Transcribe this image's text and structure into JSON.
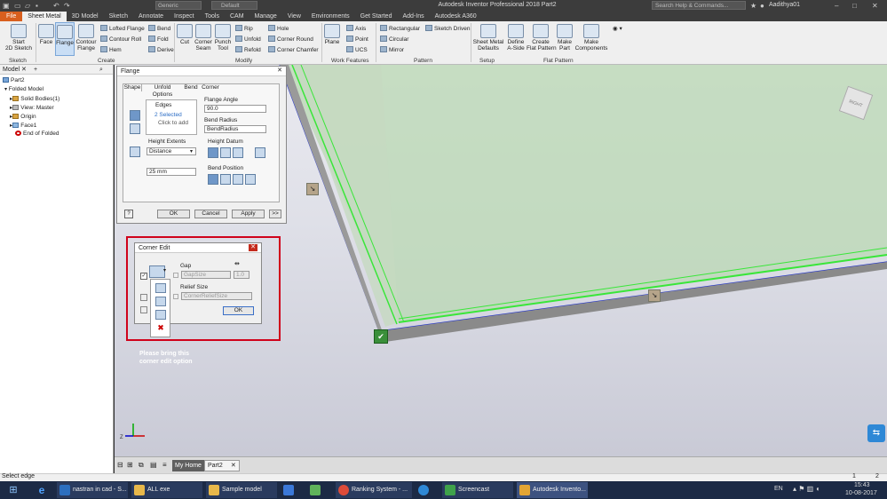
{
  "app": {
    "title": "Autodesk Inventor Professional 2018    Part2",
    "search_placeholder": "Search Help & Commands...",
    "user": "Aadithya01",
    "material": "Generic",
    "appearance": "Default"
  },
  "menu_tabs": [
    "File",
    "Sheet Metal",
    "3D Model",
    "Sketch",
    "Annotate",
    "Inspect",
    "Tools",
    "CAM",
    "Manage",
    "View",
    "Environments",
    "Get Started",
    "Add-Ins",
    "Autodesk A360"
  ],
  "ribbon": {
    "start_sketch": "Start\n2D Sketch",
    "face": "Face",
    "flange": "Flange",
    "contour_flange": "Contour\nFlange",
    "lofted_flange": "Lofted Flange",
    "contour_roll": "Contour Roll",
    "hem": "Hem",
    "bend": "Bend",
    "fold": "Fold",
    "derive": "Derive",
    "cut": "Cut",
    "corner_seam": "Corner\nSeam",
    "punch_tool": "Punch\nTool",
    "rip": "Rip",
    "unfold": "Unfold",
    "refold": "Refold",
    "hole": "Hole",
    "corner_round": "Corner Round",
    "corner_chamfer": "Corner Chamfer",
    "plane": "Plane",
    "axis": "Axis",
    "point": "Point",
    "ucs": "UCS",
    "rectangular": "Rectangular",
    "circular": "Circular",
    "mirror": "Mirror",
    "sketch_driven": "Sketch Driven",
    "sheet_metal_defaults": "Sheet Metal\nDefaults",
    "define_aside": "Define\nA-Side",
    "create_flat_pattern": "Create\nFlat Pattern",
    "make_part": "Make\nPart",
    "make_components": "Make\nComponents",
    "groups": {
      "sketch": "Sketch",
      "create": "Create",
      "modify": "Modify",
      "work_features": "Work Features",
      "pattern": "Pattern",
      "setup": "Setup",
      "flat_pattern": "Flat Pattern"
    }
  },
  "browser": {
    "header": "Model",
    "items": [
      "Part2",
      "Folded Model",
      "Solid Bodies(1)",
      "View: Master",
      "Origin",
      "Face1",
      "End of Folded"
    ]
  },
  "flange_dialog": {
    "title": "Flange",
    "tabs": [
      "Shape",
      "Unfold Options",
      "Bend",
      "Corner"
    ],
    "edges_label": "Edges",
    "edges_selected": "2 Selected",
    "edges_add": "Click to add",
    "flange_angle_label": "Flange Angle",
    "flange_angle": "90.0",
    "bend_radius_label": "Bend Radius",
    "bend_radius": "BendRadius",
    "height_extents_label": "Height Extents",
    "height_extents": "Distance",
    "height_value": "25 mm",
    "height_datum_label": "Height Datum",
    "bend_position_label": "Bend Position",
    "ok": "OK",
    "cancel": "Cancel",
    "apply": "Apply",
    "more": ">>"
  },
  "corner_edit": {
    "title": "Corner Edit",
    "gap_label": "Gap",
    "gap_value": "GapSize",
    "gap_num": "1.0",
    "relief_label": "Relief Size",
    "relief_value": "CornerReliefSize",
    "ok": "OK"
  },
  "annotation": "Please bring this\ncorner edit option",
  "doc_tabs": [
    "My Home",
    "Part2"
  ],
  "status": {
    "left": "Select edge",
    "n1": "1",
    "n2": "2"
  },
  "taskbar": {
    "items": [
      "nastran in cad - S...",
      "ALL exe",
      "Sample model",
      "",
      "",
      "Ranking System - ...",
      "",
      "Screencast",
      "Autodesk Invento..."
    ],
    "lang": "EN",
    "time": "15:43",
    "date": "10-08-2017"
  },
  "colors": {
    "accent": "#d85f1e",
    "selection_green": "#39e639",
    "highlight_blue": "#2233cc",
    "annotation_red": "#d0021b"
  }
}
